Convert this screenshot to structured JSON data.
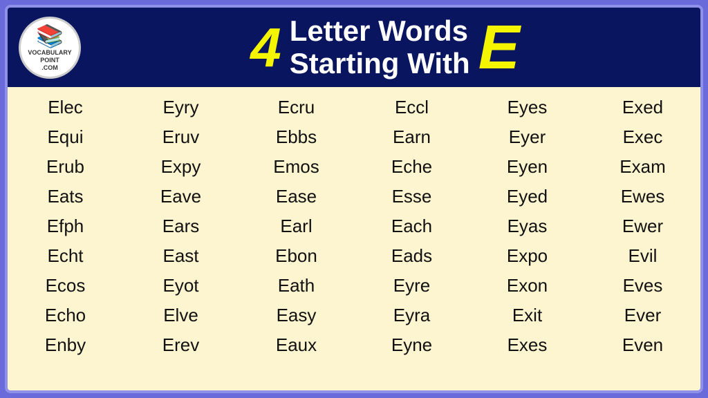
{
  "header": {
    "logo": {
      "figure": "📚",
      "line1": "VOCABULARY",
      "line2": "POINT",
      "line3": ".COM"
    },
    "number": "4",
    "title_line1": "Letter Words",
    "title_line2": "Starting With",
    "letter": "E"
  },
  "words": [
    [
      "Elec",
      "Eyry",
      "Ecru",
      "Eccl",
      "Eyes",
      "Exed"
    ],
    [
      "Equi",
      "Eruv",
      "Ebbs",
      "Earn",
      "Eyer",
      "Exec"
    ],
    [
      "Erub",
      "Expy",
      "Emos",
      "Eche",
      "Eyen",
      "Exam"
    ],
    [
      "Eats",
      "Eave",
      "Ease",
      "Esse",
      "Eyed",
      "Ewes"
    ],
    [
      "Efph",
      "Ears",
      "Earl",
      "Each",
      "Eyas",
      "Ewer"
    ],
    [
      "Echt",
      "East",
      "Ebon",
      "Eads",
      "Expo",
      "Evil"
    ],
    [
      "Ecos",
      "Eyot",
      "Eath",
      "Eyre",
      "Exon",
      "Eves"
    ],
    [
      "Echo",
      "Elve",
      "Easy",
      "Eyra",
      "Exit",
      "Ever"
    ],
    [
      "Enby",
      "Erev",
      "Eaux",
      "Eyne",
      "Exes",
      "Even"
    ]
  ]
}
